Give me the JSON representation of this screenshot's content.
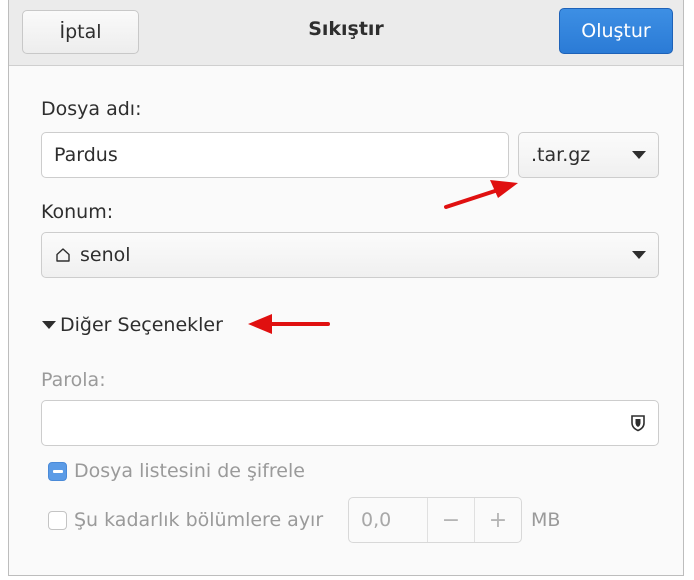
{
  "dialog": {
    "title": "Sıkıştır",
    "cancel_label": "İptal",
    "create_label": "Oluştur"
  },
  "filename": {
    "label": "Dosya adı:",
    "value": "Pardus",
    "extension": ".tar.gz"
  },
  "location": {
    "label": "Konum:",
    "value": "senol",
    "icon": "home-icon"
  },
  "other_options": {
    "label": "Diğer Seçenekler",
    "expanded": true
  },
  "password": {
    "label": "Parola:",
    "value": "",
    "icon": "shield-icon"
  },
  "encrypt_list": {
    "label": "Dosya listesini de şifrele",
    "state": "mixed"
  },
  "split": {
    "label": "Şu kadarlık bölümlere ayır",
    "checked": false,
    "value": "0,0",
    "minus": "−",
    "plus": "+",
    "unit": "MB"
  },
  "colors": {
    "accent": "#2b7bd6",
    "annotation_arrow": "#e01010"
  }
}
